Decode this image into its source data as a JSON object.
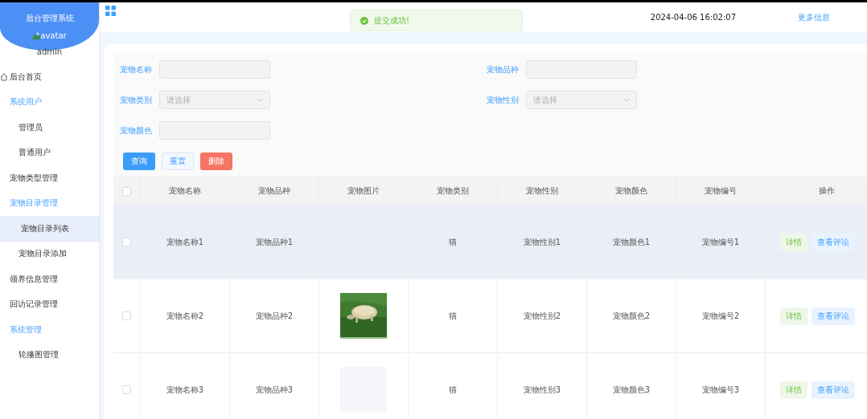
{
  "sidebar": {
    "title": "后台管理系统",
    "avatar_alt": "avatar",
    "username": "admin",
    "items": [
      {
        "kind": "home",
        "label": "后台首页",
        "selected": false
      },
      {
        "kind": "group",
        "label": "系统用户",
        "children": [
          {
            "label": "管理员",
            "selected": false
          },
          {
            "label": "普通用户",
            "selected": false
          }
        ]
      },
      {
        "kind": "item",
        "label": "宠物类型管理",
        "selected": false
      },
      {
        "kind": "group",
        "label": "宠物目录管理",
        "children": [
          {
            "label": "宠物目录列表",
            "selected": true
          },
          {
            "label": "宠物目录添加",
            "selected": false
          }
        ]
      },
      {
        "kind": "item",
        "label": "领养信息管理",
        "selected": false
      },
      {
        "kind": "item",
        "label": "回访记录管理",
        "selected": false
      },
      {
        "kind": "group",
        "label": "系统管理",
        "children": [
          {
            "label": "轮播图管理",
            "selected": false
          }
        ]
      }
    ]
  },
  "header": {
    "datetime": "2024-04-06 16:02:07",
    "more_link": "更多信息"
  },
  "toast": {
    "message": "提交成功!"
  },
  "search": {
    "fields": [
      {
        "kind": "text",
        "label": "宠物名称"
      },
      {
        "kind": "text",
        "label": "宠物品种"
      },
      {
        "kind": "select",
        "label": "宠物类别",
        "placeholder": "请选择"
      },
      {
        "kind": "select",
        "label": "宠物性别",
        "placeholder": "请选择"
      },
      {
        "kind": "text",
        "label": "宠物颜色"
      }
    ],
    "buttons": [
      {
        "kind": "primary",
        "label": "查询"
      },
      {
        "kind": "plain",
        "label": "重置"
      },
      {
        "kind": "danger",
        "label": "删除"
      }
    ]
  },
  "table": {
    "columns": [
      "宠物名称",
      "宠物品种",
      "宠物图片",
      "宠物类别",
      "宠物性别",
      "宠物颜色",
      "宠物编号",
      "操作"
    ],
    "select_all_checked": false,
    "rows": [
      {
        "name": "宠物名称1",
        "breed": "宠物品种1",
        "category": "猫",
        "gender": "宠物性别1",
        "pet_color": "宠物颜色1",
        "number": "宠物编号1",
        "hovered": true,
        "checked": false,
        "actions": [
          "详情",
          "查看评论"
        ]
      },
      {
        "name": "宠物名称2",
        "breed": "宠物品种2",
        "image": {
          "kind": "picture"
        },
        "category": "猫",
        "gender": "宠物性别2",
        "pet_color": "宠物颜色2",
        "number": "宠物编号2",
        "hovered": false,
        "checked": false,
        "actions": [
          "详情",
          "查看评论"
        ]
      },
      {
        "name": "宠物名称3",
        "breed": "宠物品种3",
        "image": {
          "kind": "placeholder"
        },
        "category": "猫",
        "gender": "宠物性别3",
        "pet_color": "宠物颜色3",
        "number": "宠物编号3",
        "hovered": false,
        "checked": false,
        "actions": [
          "详情",
          "查看评论"
        ]
      }
    ]
  }
}
